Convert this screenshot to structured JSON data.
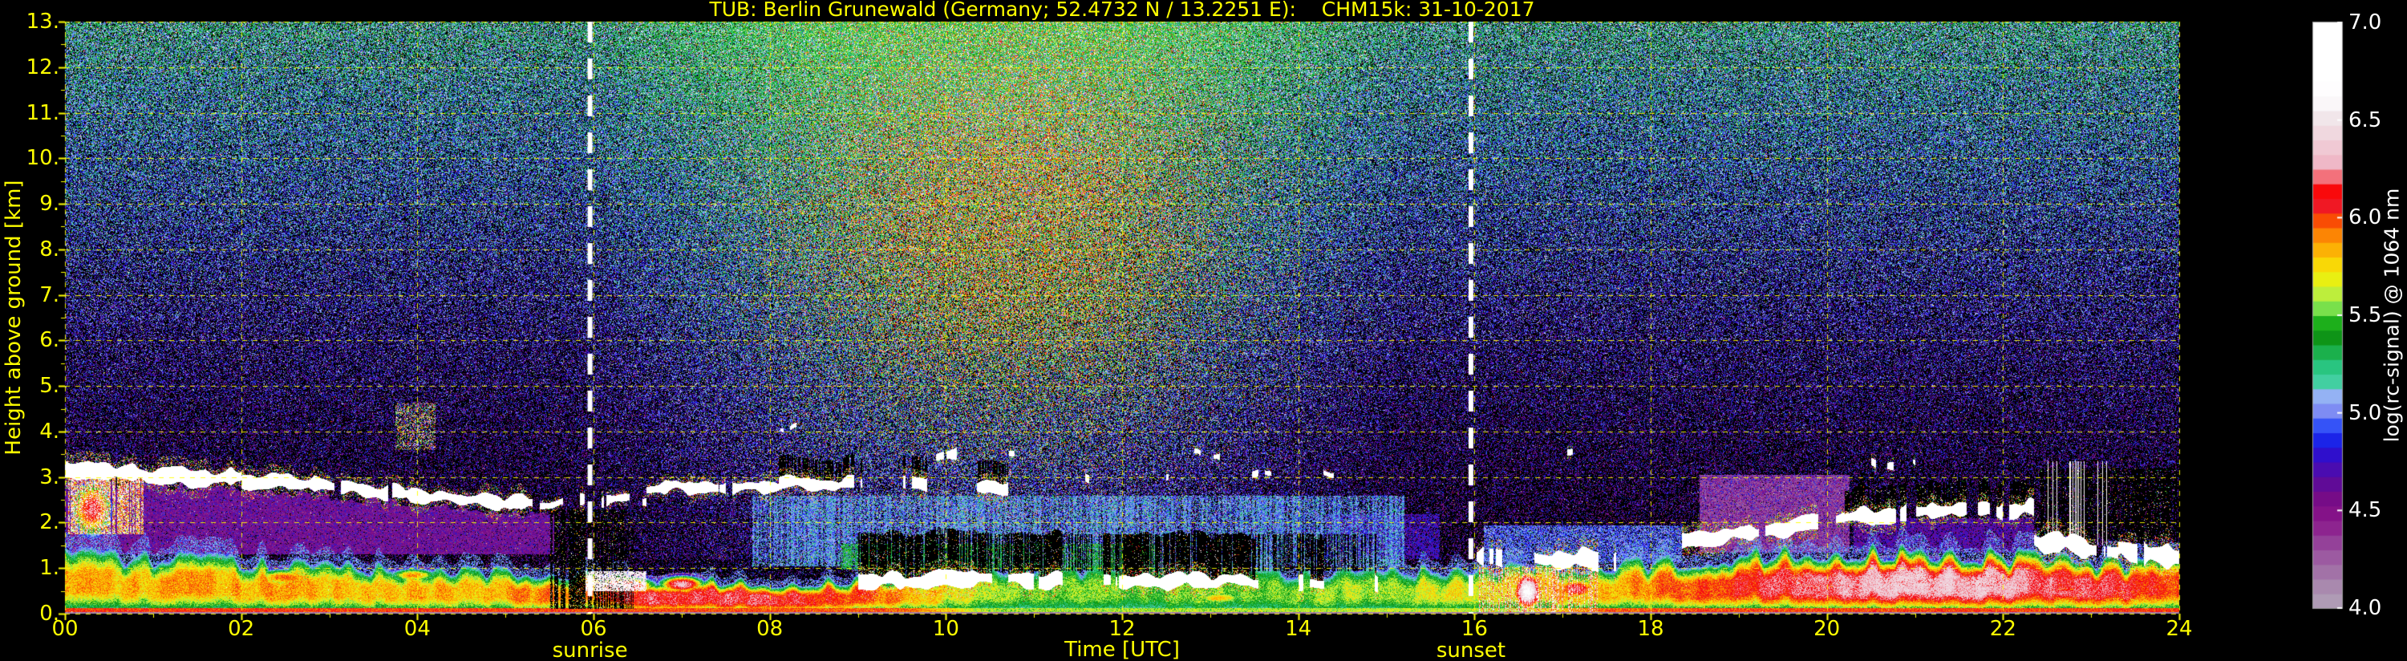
{
  "colors": {
    "background": "#000000",
    "axis_text": "#ffff00",
    "colorbar_text": "#ffffff",
    "grid": "#ffff00",
    "sun_line": "#ffffff"
  },
  "chart_data": {
    "type": "heatmap",
    "title": "TUB: Berlin Grunewald (Germany; 52.4732 N / 13.2251 E):    CHM15k: 31-10-2017",
    "xlabel": "Time [UTC]",
    "ylabel": "Height above ground [km]",
    "xlim": [
      0,
      24
    ],
    "ylim": [
      0,
      13
    ],
    "grid": "dashed yellow major grid, horizontal every 1 km, vertical every 2 h",
    "x_ticks": [
      "00",
      "02",
      "04",
      "06",
      "08",
      "10",
      "12",
      "14",
      "16",
      "18",
      "20",
      "22",
      "24"
    ],
    "x_tick_values": [
      0,
      2,
      4,
      6,
      8,
      10,
      12,
      14,
      16,
      18,
      20,
      22,
      24
    ],
    "y_ticks": [
      "13.",
      "12.",
      "11.",
      "10.",
      "9.",
      "8.",
      "7.",
      "6.",
      "5.",
      "4.",
      "3.",
      "2.",
      "1.",
      "0."
    ],
    "y_tick_values": [
      13,
      12,
      11,
      10,
      9,
      8,
      7,
      6,
      5,
      4,
      3,
      2,
      1,
      0
    ],
    "annotations": [
      {
        "label": "sunrise",
        "time": 5.96
      },
      {
        "label": "sunset",
        "time": 15.96
      }
    ],
    "colorbar": {
      "label": "log(rc-signal) @ 1064 nm",
      "min": 4.0,
      "max": 7.0,
      "ticks": [
        "7.0",
        "6.5",
        "6.0",
        "5.5",
        "5.0",
        "4.5",
        "4.0"
      ],
      "tick_values": [
        7.0,
        6.5,
        6.0,
        5.5,
        5.0,
        4.5,
        4.0
      ],
      "stops": [
        [
          4.0,
          "#b2a4b8"
        ],
        [
          4.12,
          "#a887ad"
        ],
        [
          4.24,
          "#9e62a3"
        ],
        [
          4.35,
          "#933d98"
        ],
        [
          4.45,
          "#8a158a"
        ],
        [
          4.55,
          "#7a0c84"
        ],
        [
          4.65,
          "#5c0b9a"
        ],
        [
          4.75,
          "#3f0cbd"
        ],
        [
          4.83,
          "#1d12dc"
        ],
        [
          4.9,
          "#1838f6"
        ],
        [
          4.96,
          "#4763f7"
        ],
        [
          5.02,
          "#8692f3"
        ],
        [
          5.08,
          "#95aef5"
        ],
        [
          5.12,
          "#8fc2f2"
        ],
        [
          5.16,
          "#43cfa2"
        ],
        [
          5.22,
          "#2cc98b"
        ],
        [
          5.28,
          "#23bb64"
        ],
        [
          5.34,
          "#14a637"
        ],
        [
          5.4,
          "#0c8f0e"
        ],
        [
          5.47,
          "#1fb31c"
        ],
        [
          5.54,
          "#7ce24d"
        ],
        [
          5.62,
          "#c4ef3a"
        ],
        [
          5.7,
          "#f0ef0a"
        ],
        [
          5.78,
          "#fcd105"
        ],
        [
          5.86,
          "#fca405"
        ],
        [
          5.93,
          "#fc7a04"
        ],
        [
          5.99,
          "#f94a04"
        ],
        [
          6.05,
          "#ee1a28"
        ],
        [
          6.15,
          "#fb0707"
        ],
        [
          6.25,
          "#eeb0c0"
        ],
        [
          6.38,
          "#f0cdd7"
        ],
        [
          6.5,
          "#efe3e7"
        ],
        [
          6.6,
          "#fcfafb"
        ],
        [
          6.7,
          "#ffffff"
        ],
        [
          7.0,
          "#ffffff"
        ]
      ]
    },
    "features": {
      "background": {
        "speckle_base": 0.22,
        "speckle_alt": 0.55,
        "day_boost": 0.3,
        "warm_center_t": 10.9,
        "warm_center_h": 8.4,
        "day_start": 5.8,
        "day_len": 9.4
      },
      "bl_top": [
        [
          0,
          1.3
        ],
        [
          1.5,
          1.2
        ],
        [
          3,
          1.05
        ],
        [
          4.5,
          0.95
        ],
        [
          5.5,
          0.92
        ],
        [
          6.5,
          0.8
        ],
        [
          8,
          0.68
        ],
        [
          9,
          0.75
        ],
        [
          10,
          0.9
        ],
        [
          11.5,
          1.0
        ],
        [
          13,
          0.92
        ],
        [
          15,
          0.95
        ],
        [
          16,
          1.0
        ],
        [
          17,
          1.08
        ],
        [
          18,
          1.12
        ],
        [
          19,
          1.3
        ],
        [
          20,
          1.4
        ],
        [
          21,
          1.35
        ],
        [
          22,
          1.3
        ],
        [
          23,
          1.15
        ],
        [
          24,
          1.1
        ]
      ],
      "v_surface": [
        [
          0,
          5.8
        ],
        [
          2,
          5.85
        ],
        [
          4,
          5.8
        ],
        [
          5.5,
          5.9
        ],
        [
          6.5,
          6.15
        ],
        [
          7.5,
          6.2
        ],
        [
          8.5,
          6.1
        ],
        [
          9.5,
          5.85
        ],
        [
          10.5,
          5.55
        ],
        [
          12,
          5.5
        ],
        [
          14,
          5.55
        ],
        [
          15.5,
          5.65
        ],
        [
          16.5,
          5.8
        ],
        [
          17.5,
          5.85
        ],
        [
          18.5,
          6.0
        ],
        [
          19.5,
          6.15
        ],
        [
          20.5,
          6.3
        ],
        [
          21.5,
          6.35
        ],
        [
          22.5,
          6.2
        ],
        [
          23.5,
          6.1
        ],
        [
          24,
          6.0
        ]
      ],
      "ground_v": [
        [
          0,
          5.95
        ],
        [
          9.5,
          5.9
        ],
        [
          10.5,
          5.5
        ],
        [
          16.5,
          5.55
        ],
        [
          17.5,
          5.9
        ],
        [
          24,
          5.95
        ]
      ],
      "night_region_top": [
        [
          0,
          2.98
        ],
        [
          2,
          2.82
        ],
        [
          5.3,
          2.28
        ],
        [
          5.55,
          2.28
        ]
      ],
      "regions": [
        {
          "t0": 0,
          "t1": 5.55,
          "h0": 1.32,
          "h1": 2.8,
          "useNightTop": true,
          "v": 4.36,
          "dv": 0.34,
          "dens": 0.93
        },
        {
          "t0": 7.8,
          "t1": 15.2,
          "h0": 1.05,
          "h1": 2.6,
          "v": 4.85,
          "dv": 0.38,
          "dens": 0.8,
          "streak": true
        },
        {
          "t0": 8.8,
          "t1": 12.4,
          "h0": 0.98,
          "h1": 1.55,
          "v": 5.22,
          "dv": 0.3,
          "dens": 0.7,
          "streak": true
        },
        {
          "t0": 16.1,
          "t1": 18.35,
          "h0": 1.15,
          "h1": 1.95,
          "v": 4.8,
          "dv": 0.35,
          "dens": 0.75
        },
        {
          "t0": 18.55,
          "t1": 20.25,
          "h0": 1.35,
          "h1": 3.05,
          "v": 4.18,
          "dv": 0.28,
          "dens": 0.95
        },
        {
          "t0": 20.3,
          "t1": 22.35,
          "h0": 1.35,
          "h1": 2.1,
          "v": 4.5,
          "dv": 0.3,
          "dens": 0.8
        },
        {
          "t0": 14.3,
          "t1": 15.6,
          "h0": 1.2,
          "h1": 2.2,
          "v": 4.55,
          "dv": 0.35,
          "dens": 0.7
        }
      ],
      "clouds": [
        [
          0,
          3.12,
          2,
          2.96,
          0.18,
          0.05,
          0
        ],
        [
          2,
          2.96,
          5.3,
          2.4,
          0.16,
          0.12,
          0
        ],
        [
          5.3,
          2.42,
          6.6,
          2.52,
          0.12,
          0.42,
          0
        ],
        [
          6.6,
          2.78,
          8.1,
          2.84,
          0.14,
          0.3,
          0
        ],
        [
          8.1,
          2.9,
          10.7,
          2.78,
          0.13,
          0.5,
          0.45
        ],
        [
          10.7,
          2.95,
          12.0,
          3.0,
          0.1,
          0.65,
          0
        ],
        [
          8.6,
          3.52,
          12.7,
          3.42,
          0.12,
          0.72,
          0
        ],
        [
          12.5,
          3.05,
          14.4,
          3.1,
          0.1,
          0.75,
          0
        ],
        [
          9.0,
          0.76,
          14.9,
          0.7,
          0.17,
          0.45,
          0.9
        ],
        [
          16.0,
          1.3,
          17.6,
          1.18,
          0.2,
          0.35,
          0
        ],
        [
          18.35,
          1.55,
          20.2,
          2.08,
          0.16,
          0.25,
          0
        ],
        [
          20.2,
          2.12,
          22.35,
          2.32,
          0.17,
          0.3,
          0.5
        ],
        [
          20.5,
          3.32,
          21.0,
          3.3,
          0.08,
          0.7,
          0
        ],
        [
          17.05,
          3.5,
          17.35,
          3.5,
          0.07,
          0.6,
          0
        ],
        [
          19.3,
          3.68,
          19.6,
          3.66,
          0.06,
          0.65,
          0
        ],
        [
          22.35,
          1.6,
          23.3,
          1.4,
          0.22,
          0.15,
          0
        ],
        [
          23.3,
          1.4,
          24,
          1.3,
          0.26,
          0.12,
          0
        ],
        [
          7.3,
          4.05,
          8.3,
          4.1,
          0.07,
          0.8,
          0
        ],
        [
          12.2,
          3.55,
          13.4,
          3.5,
          0.09,
          0.7,
          0
        ]
      ],
      "streaks": [
        {
          "mode": "black",
          "t0": 5.5,
          "t1": 6.45,
          "h0": 0,
          "h1": 2.3,
          "dens": 0.7,
          "speck": 0.06
        },
        {
          "mode": "black",
          "t0": 9.0,
          "t1": 14.9,
          "h0": 0.95,
          "h1": 1.75,
          "dens": 0.5,
          "speck": 0.05
        },
        {
          "mode": "black",
          "t0": 22.4,
          "t1": 24,
          "h0": 1.65,
          "h1": 3.2,
          "dens": 0.85,
          "speck": 0.04
        },
        {
          "mode": "below-cloud",
          "t0": 0.02,
          "t1": 0.9,
          "h0": 1.75,
          "h1": 3.2,
          "dens": 0.85,
          "vmin": 5.5,
          "vmax": 6.9
        },
        {
          "mode": "band",
          "t0": 5.9,
          "t1": 6.6,
          "h0": 0.5,
          "h1": 0.95,
          "dens": 0.8,
          "vmin": 6.3,
          "vmax": 7.0
        },
        {
          "mode": "streak",
          "t0": 16.05,
          "t1": 17.4,
          "h0": 0.02,
          "h1": 1.05,
          "dens": 0.55,
          "vmin": 5.7,
          "vmax": 6.9
        },
        {
          "mode": "whitecol",
          "t0": 22.45,
          "t1": 23.25,
          "h0": 1.5,
          "h1": 3.35,
          "dens": 0.12,
          "vmin": 6.4,
          "vmax": 7.0
        },
        {
          "mode": "speckle",
          "t0": 3.75,
          "t1": 4.2,
          "h0": 3.6,
          "h1": 4.65,
          "dens": 0.4,
          "vmin": 4.9,
          "vmax": 6.6
        }
      ],
      "patches": [
        [
          2.5,
          0.8,
          0.6,
          0.28,
          6.1
        ],
        [
          3.95,
          0.85,
          0.4,
          0.22,
          6.05
        ],
        [
          0.3,
          2.3,
          0.3,
          0.8,
          6.3
        ],
        [
          6.35,
          0.6,
          0.5,
          0.3,
          6.45
        ],
        [
          7.0,
          0.65,
          0.35,
          0.25,
          6.5
        ],
        [
          13.1,
          0.35,
          0.5,
          0.22,
          5.95
        ],
        [
          16.6,
          0.5,
          0.22,
          0.55,
          6.8
        ],
        [
          17.15,
          0.55,
          0.4,
          0.35,
          6.3
        ],
        [
          19.9,
          0.75,
          0.8,
          0.45,
          6.4
        ],
        [
          20.9,
          0.8,
          0.9,
          0.5,
          6.5
        ],
        [
          21.8,
          0.75,
          0.7,
          0.45,
          6.45
        ],
        [
          22.7,
          0.45,
          0.6,
          0.3,
          6.35
        ],
        [
          23.4,
          0.42,
          0.55,
          0.28,
          6.25
        ]
      ]
    }
  }
}
